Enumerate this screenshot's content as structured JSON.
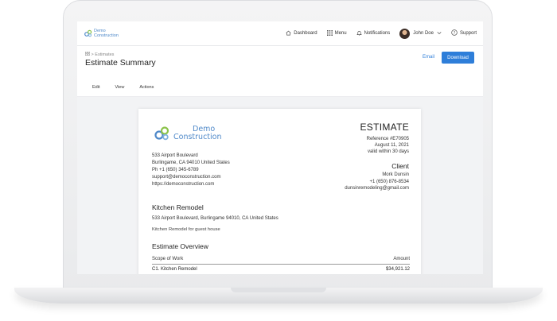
{
  "nav": {
    "brand_line1": "Demo",
    "brand_line2": "Construction",
    "items": [
      {
        "label": "Dashboard",
        "icon": "home-icon"
      },
      {
        "label": "Menu",
        "icon": "grid-icon"
      },
      {
        "label": "Notifications",
        "icon": "bell-icon"
      }
    ],
    "user_name": "John Doe",
    "support_label": "Support"
  },
  "header": {
    "breadcrumb": "Estimates",
    "title": "Estimate Summary",
    "email_label": "Email",
    "download_label": "Download",
    "tabs": [
      "Edit",
      "View",
      "Actions"
    ]
  },
  "document": {
    "logo_line1": "Demo",
    "logo_line2": "Construction",
    "company_lines": [
      "533 Airport Boulevard",
      "Burlingame, CA 94010 United States",
      "Ph +1 (650) 345-6789",
      "support@democonstruction.com",
      "https://democonstruction.com"
    ],
    "estimate_title": "ESTIMATE",
    "estimate_meta": [
      "Reference #E70905",
      "August 11, 2021",
      "valid within 30 days"
    ],
    "client_title": "Client",
    "client_lines": [
      "Mork Dunsin",
      "+1 (650) 876-8534",
      "dunsinremodeling@gmail.com"
    ],
    "project_title": "Kitchen Remodel",
    "project_address": "533 Airport Boulevard, Burlingame 94010, CA United States",
    "project_description": "Kitchen Remodel for guest house",
    "overview_title": "Estimate Overview",
    "table_header": {
      "scope": "Scope of Work",
      "amount": "Amount"
    },
    "rows": [
      {
        "scope": "C1. Kitchen Remodel",
        "amount": "$34,921.12"
      }
    ]
  },
  "colors": {
    "accent": "#2e7ed9",
    "brand": "#4f89c9"
  }
}
